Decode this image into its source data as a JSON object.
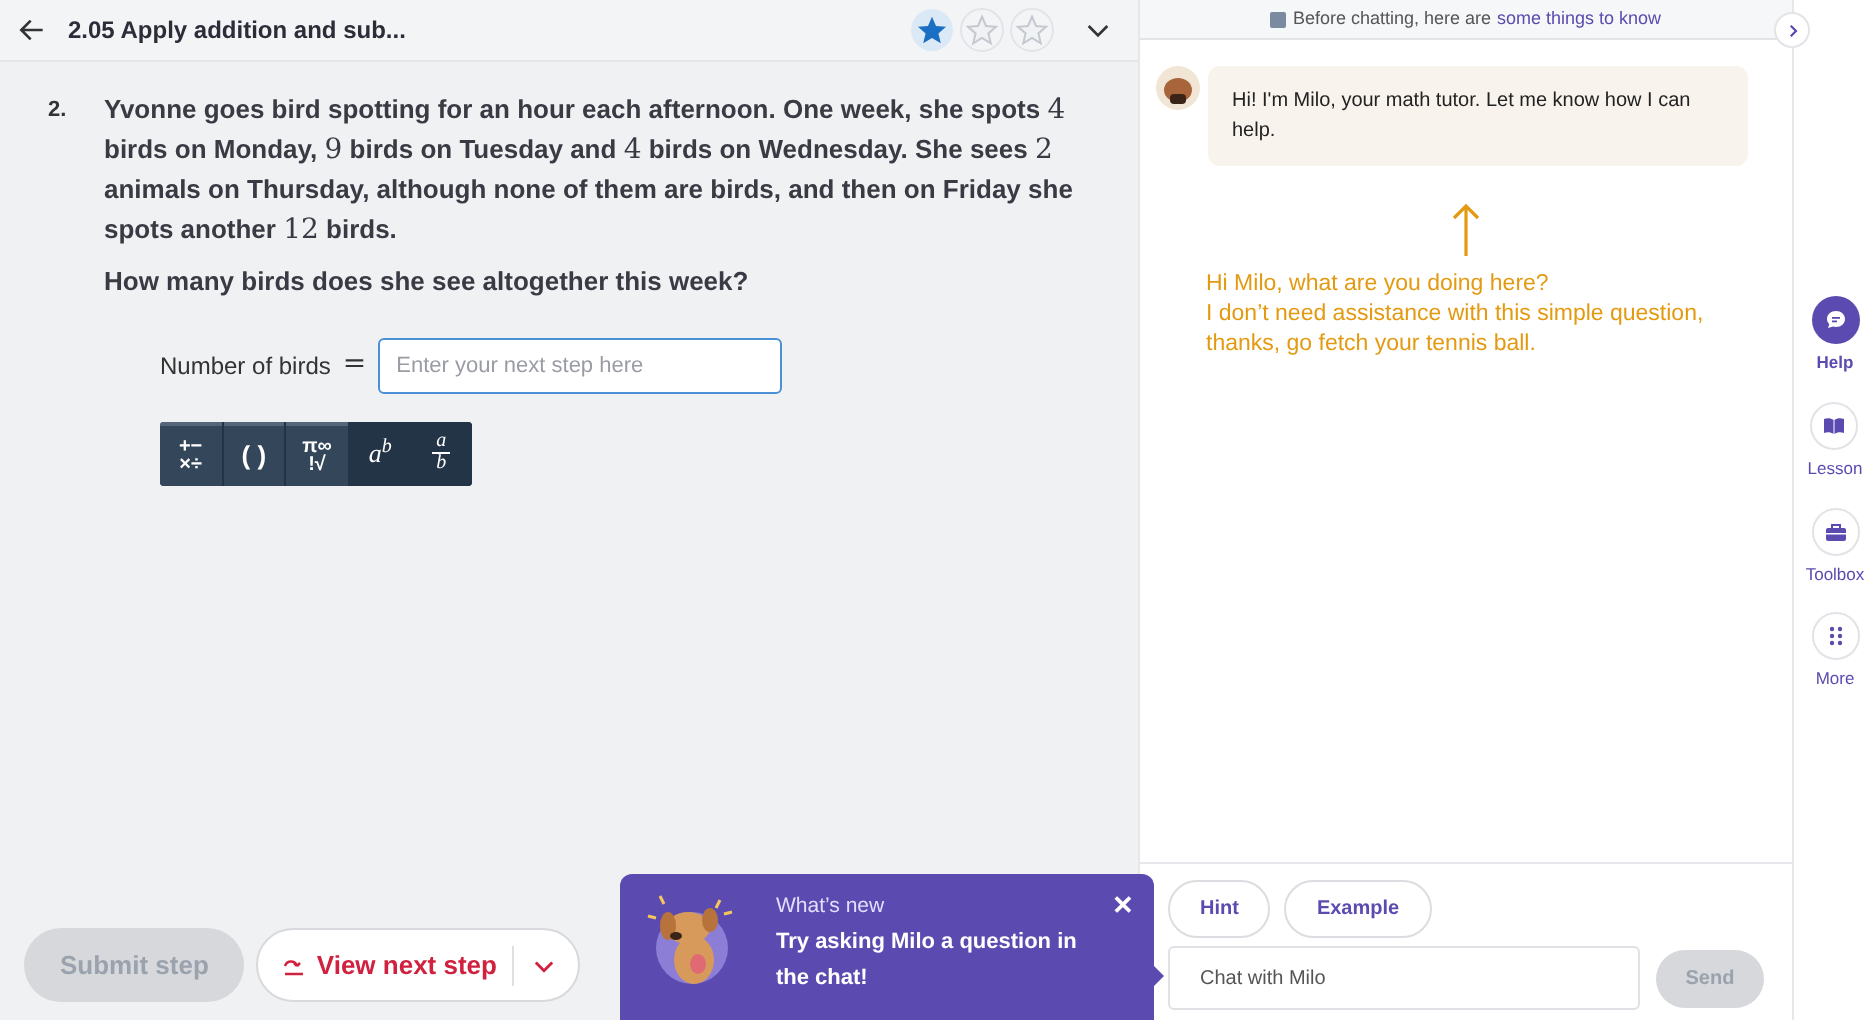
{
  "header": {
    "title": "2.05 Apply addition and sub...",
    "stars": 1
  },
  "question": {
    "number": "2.",
    "paragraph": [
      {
        "kind": "text",
        "text": "Yvonne goes bird spotting for an hour each afternoon. One week, she spots "
      },
      {
        "kind": "math",
        "text": "4"
      },
      {
        "kind": "text",
        "text": " birds on Monday, "
      },
      {
        "kind": "math",
        "text": "9"
      },
      {
        "kind": "text",
        "text": " birds on Tuesday and "
      },
      {
        "kind": "math",
        "text": "4"
      },
      {
        "kind": "text",
        "text": " birds on Wednesday. She sees "
      },
      {
        "kind": "math",
        "text": "2"
      },
      {
        "kind": "text",
        "text": " animals on Thursday, although none of them are birds, and then on Friday she spots another "
      },
      {
        "kind": "math",
        "text": "12"
      },
      {
        "kind": "text",
        "text": " birds."
      }
    ],
    "prompt": "How many birds does she see altogether this week?"
  },
  "answer": {
    "label": "Number of birds",
    "equals": "=",
    "placeholder": "Enter your next step here"
  },
  "keyboard": [
    {
      "kind": "grid",
      "top": "+−",
      "bottom": "×÷"
    },
    {
      "kind": "single",
      "symbol": "( )"
    },
    {
      "kind": "grid",
      "top": "π∞",
      "bottom": "!√"
    },
    {
      "kind": "power",
      "base": "a",
      "exponent": "b"
    },
    {
      "kind": "fraction",
      "numerator": "a",
      "denominator": "b"
    }
  ],
  "footer": {
    "submit": {
      "label": "Submit step",
      "disabled": true
    },
    "next": {
      "label": "View next step"
    }
  },
  "popup": {
    "heading": "What’s new",
    "message": "Try asking Milo a question in the chat!",
    "close": "✕"
  },
  "chat": {
    "banner": {
      "text": "Before chatting, here are",
      "link": "some things to know"
    },
    "messages": [
      {
        "text": "Hi! I'm Milo, your math tutor. Let me know how I can help."
      }
    ],
    "annotation": {
      "lines": [
        "Hi Milo, what are you doing here?",
        "I don’t need assistance with this simple question,",
        "thanks, go fetch your tennis ball."
      ]
    },
    "chips": [
      "Hint",
      "Example"
    ],
    "input": {
      "placeholder": "Chat with Milo"
    },
    "send": {
      "label": "Send",
      "disabled": true
    }
  },
  "rail": [
    {
      "kind": "chat",
      "label": "Help",
      "selected": true
    },
    {
      "kind": "book",
      "label": "Lesson",
      "selected": false
    },
    {
      "kind": "toolbox",
      "label": "Toolbox",
      "selected": false
    },
    {
      "kind": "dots",
      "label": "More",
      "selected": false
    }
  ]
}
